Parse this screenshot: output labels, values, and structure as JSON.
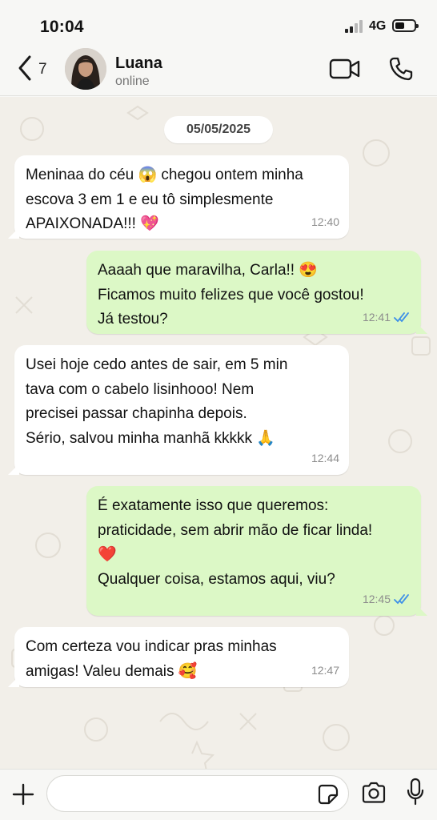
{
  "status_bar": {
    "time": "10:04",
    "network": "4G"
  },
  "header": {
    "back_count": "7",
    "contact_name": "Luana",
    "contact_status": "online"
  },
  "chat": {
    "date": "05/05/2025",
    "messages": [
      {
        "direction": "incoming",
        "lines": [
          "Meninaa do céu 😱 chegou ontem minha",
          "escova 3 em 1 e eu tô simplesmente",
          "APAIXONADA!!! 💖"
        ],
        "time": "12:40"
      },
      {
        "direction": "outgoing",
        "lines": [
          "Aaaah que maravilha, Carla!! 😍",
          "Ficamos muito felizes que você gostou!",
          "Já testou?"
        ],
        "time": "12:41",
        "read": true
      },
      {
        "direction": "incoming",
        "lines": [
          "Usei hoje cedo antes de sair, em 5 min",
          "tava com o cabelo lisinhooo! Nem",
          "precisei passar chapinha depois.",
          "Sério, salvou minha manhã kkkkk 🙏"
        ],
        "time": "12:44"
      },
      {
        "direction": "outgoing",
        "lines": [
          "É exatamente isso que queremos:",
          "praticidade, sem abrir mão de ficar linda!",
          "❤️",
          "Qualquer coisa, estamos aqui, viu?"
        ],
        "time": "12:45",
        "read": true
      },
      {
        "direction": "incoming",
        "lines": [
          "Com certeza vou indicar pras minhas",
          "amigas! Valeu demais 🥰"
        ],
        "time": "12:47"
      }
    ]
  },
  "input": {
    "placeholder": ""
  },
  "icons": {
    "back": "chevron-left-icon",
    "video": "video-camera-icon",
    "call": "phone-icon",
    "plus": "plus-icon",
    "sticker": "sticker-icon",
    "camera": "camera-icon",
    "mic": "microphone-icon",
    "read_receipt": "double-check-icon"
  },
  "colors": {
    "incoming_bubble": "#ffffff",
    "outgoing_bubble": "#dcf8c6",
    "read_ticks": "#3b8ee8",
    "chat_background": "#f2efe9"
  }
}
